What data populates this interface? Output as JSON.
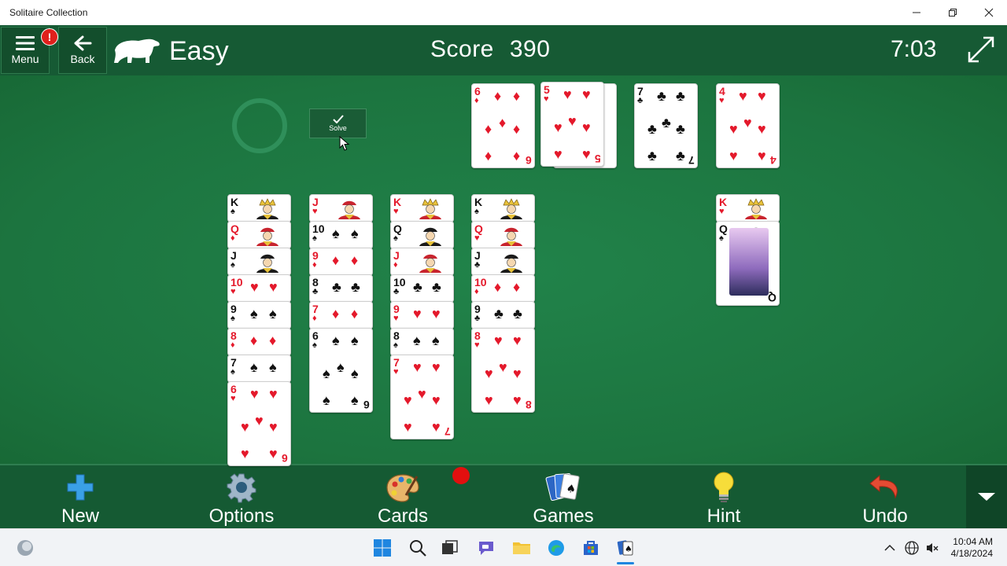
{
  "window": {
    "title": "Solitaire Collection"
  },
  "header": {
    "menu_label": "Menu",
    "menu_badge": "!",
    "back_label": "Back",
    "difficulty": "Easy",
    "score_label": "Score",
    "score_value": "390",
    "timer": "7:03"
  },
  "board": {
    "solve_label": "Solve",
    "foundation": [
      {
        "rank": "6",
        "suit": "♦",
        "color": "red"
      },
      {
        "rank": "5",
        "suit": "♥",
        "color": "red"
      },
      {
        "rank": "7",
        "suit": "♣",
        "color": "black"
      },
      {
        "rank": "4",
        "suit": "♥",
        "color": "red"
      }
    ],
    "tableau": [
      [
        {
          "rank": "K",
          "suit": "♠",
          "color": "black"
        },
        {
          "rank": "Q",
          "suit": "♦",
          "color": "red"
        },
        {
          "rank": "J",
          "suit": "♠",
          "color": "black"
        },
        {
          "rank": "10",
          "suit": "♥",
          "color": "red"
        },
        {
          "rank": "9",
          "suit": "♠",
          "color": "black"
        },
        {
          "rank": "8",
          "suit": "♦",
          "color": "red"
        },
        {
          "rank": "7",
          "suit": "♠",
          "color": "black"
        },
        {
          "rank": "6",
          "suit": "♥",
          "color": "red"
        }
      ],
      [
        {
          "rank": "J",
          "suit": "♥",
          "color": "red"
        },
        {
          "rank": "10",
          "suit": "♠",
          "color": "black"
        },
        {
          "rank": "9",
          "suit": "♦",
          "color": "red"
        },
        {
          "rank": "8",
          "suit": "♣",
          "color": "black"
        },
        {
          "rank": "7",
          "suit": "♦",
          "color": "red"
        },
        {
          "rank": "6",
          "suit": "♠",
          "color": "black"
        }
      ],
      [
        {
          "rank": "K",
          "suit": "♥",
          "color": "red"
        },
        {
          "rank": "Q",
          "suit": "♠",
          "color": "black"
        },
        {
          "rank": "J",
          "suit": "♦",
          "color": "red"
        },
        {
          "rank": "10",
          "suit": "♣",
          "color": "black"
        },
        {
          "rank": "9",
          "suit": "♥",
          "color": "red"
        },
        {
          "rank": "8",
          "suit": "♠",
          "color": "black"
        },
        {
          "rank": "7",
          "suit": "♥",
          "color": "red"
        }
      ],
      [
        {
          "rank": "K",
          "suit": "♠",
          "color": "black"
        },
        {
          "rank": "Q",
          "suit": "♥",
          "color": "red"
        },
        {
          "rank": "J",
          "suit": "♣",
          "color": "black"
        },
        {
          "rank": "10",
          "suit": "♦",
          "color": "red"
        },
        {
          "rank": "9",
          "suit": "♣",
          "color": "black"
        },
        {
          "rank": "8",
          "suit": "♥",
          "color": "red"
        }
      ]
    ],
    "extra_pile": [
      {
        "rank": "K",
        "suit": "♥",
        "color": "red"
      },
      {
        "rank": "Q",
        "suit": "♠",
        "color": "black"
      }
    ]
  },
  "toolbar": {
    "new_label": "New",
    "options_label": "Options",
    "cards_label": "Cards",
    "games_label": "Games",
    "hint_label": "Hint",
    "undo_label": "Undo"
  },
  "taskbar": {
    "time": "10:04 AM",
    "date": "4/18/2024"
  },
  "colors": {
    "felt": "#1f7a3a",
    "header": "#165a34",
    "card_red": "#e4192b",
    "card_black": "#111111"
  }
}
